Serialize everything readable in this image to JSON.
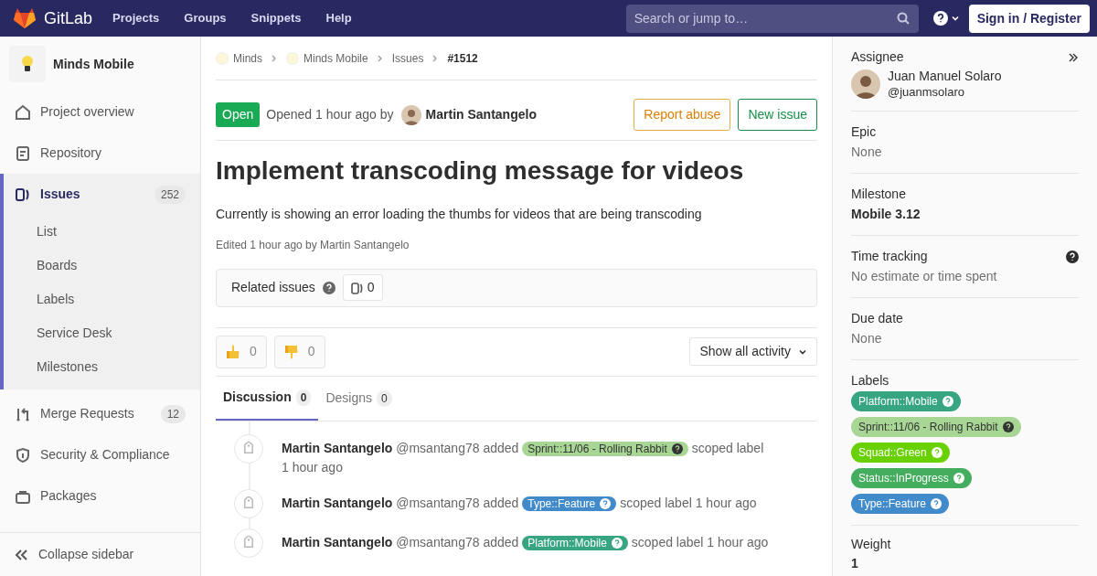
{
  "navbar": {
    "brand": "GitLab",
    "links": [
      {
        "label": "Projects"
      },
      {
        "label": "Groups"
      },
      {
        "label": "Snippets"
      },
      {
        "label": "Help"
      }
    ],
    "search": {
      "placeholder": "Search or jump to…"
    },
    "sign_in": "Sign in / Register"
  },
  "project": {
    "name": "Minds Mobile"
  },
  "sidebar": {
    "items": [
      {
        "label": "Project overview",
        "kind": "home",
        "selected": false
      },
      {
        "label": "Repository",
        "kind": "doc",
        "selected": false
      },
      {
        "label": "Issues",
        "kind": "issues",
        "count": "252",
        "selected": true,
        "children": [
          {
            "label": "List"
          },
          {
            "label": "Boards"
          },
          {
            "label": "Labels"
          },
          {
            "label": "Service Desk"
          },
          {
            "label": "Milestones"
          }
        ]
      },
      {
        "label": "Merge Requests",
        "kind": "merge",
        "count": "12",
        "selected": false
      },
      {
        "label": "Security & Compliance",
        "kind": "shield",
        "selected": false
      },
      {
        "label": "Packages",
        "kind": "package",
        "selected": false
      }
    ],
    "collapse": "Collapse sidebar"
  },
  "breadcrumbs": [
    {
      "label": "Minds",
      "kind": "avatar"
    },
    {
      "label": "Minds Mobile",
      "kind": "avatar"
    },
    {
      "label": "Issues",
      "kind": "plain"
    },
    {
      "label": "#1512",
      "kind": "current"
    }
  ],
  "issue": {
    "status": "Open",
    "opened": "Opened 1 hour ago by",
    "author": "Martin Santangelo",
    "buttons": [
      {
        "label": "Report abuse",
        "kind": "warning"
      },
      {
        "label": "New issue",
        "kind": "success"
      }
    ],
    "title": "Implement transcoding message for videos",
    "description": "Currently is showing an error loading the thumbs for videos that are being transcoding",
    "edited": "Edited 1 hour ago by Martin Santangelo"
  },
  "related": {
    "label": "Related issues",
    "count": "0"
  },
  "reactions": [
    {
      "kind": "thumbsup",
      "count": "0"
    },
    {
      "kind": "thumbsdown",
      "count": "0"
    }
  ],
  "activity_filter": "Show all activity",
  "tabs": [
    {
      "label": "Discussion",
      "count": "0",
      "selected": true
    },
    {
      "label": "Designs",
      "count": "0",
      "selected": false
    }
  ],
  "activity": [
    {
      "author": "Martin Santangelo",
      "handle": "@msantang78 added",
      "label": {
        "text": "Sprint::11/06 - Rolling Rabbit",
        "color": "#a8d695"
      },
      "suffix": "scoped label",
      "time": "1 hour ago"
    },
    {
      "author": "Martin Santangelo",
      "handle": "@msantang78 added",
      "label": {
        "text": "Type::Feature",
        "color": "#428bca"
      },
      "suffix": "scoped label",
      "time": "1 hour ago"
    },
    {
      "author": "Martin Santangelo",
      "handle": "@msantang78 added",
      "label": {
        "text": "Platform::Mobile",
        "color": "#37a581"
      },
      "suffix": "scoped label",
      "time": "1 hour ago"
    }
  ],
  "right_sidebar": {
    "assignee": {
      "heading": "Assignee",
      "name": "Juan Manuel Solaro",
      "username": "@juanmsolaro"
    },
    "sections": [
      {
        "heading": "Epic",
        "value": "None",
        "kind": "muted"
      },
      {
        "heading": "Milestone",
        "value": "Mobile 3.12",
        "kind": "bold"
      },
      {
        "heading": "Time tracking",
        "value": "No estimate or time spent",
        "kind": "muted",
        "help": true
      },
      {
        "heading": "Due date",
        "value": "None",
        "kind": "muted"
      }
    ],
    "labels": {
      "heading": "Labels",
      "items": [
        {
          "text": "Platform::Mobile",
          "color": "#37a581"
        },
        {
          "text": "Sprint::11/06 - Rolling Rabbit",
          "color": "#a8d695"
        },
        {
          "text": "Squad::Green",
          "color": "#69d100"
        },
        {
          "text": "Status::InProgress",
          "color": "#44ad5e"
        },
        {
          "text": "Type::Feature",
          "color": "#428bca"
        }
      ]
    },
    "weight": {
      "heading": "Weight",
      "value": "1"
    }
  }
}
